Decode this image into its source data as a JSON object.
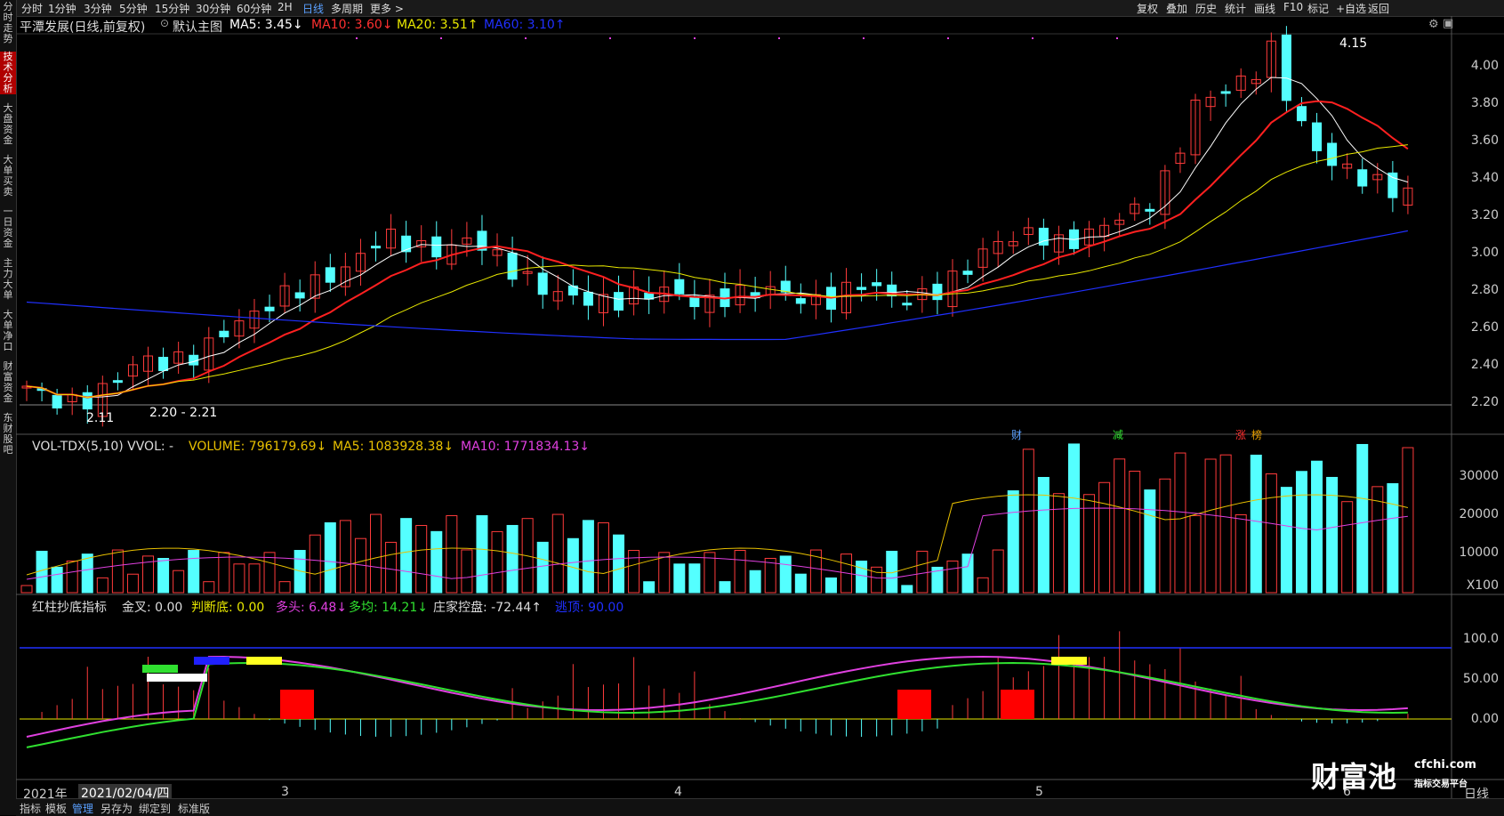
{
  "topbar": {
    "timeframes": [
      "分时",
      "1分钟",
      "3分钟",
      "5分钟",
      "15分钟",
      "30分钟",
      "60分钟",
      "2H",
      "日线",
      "多周期",
      "更多 >"
    ],
    "active": "日线",
    "right": [
      "复权",
      "叠加",
      "历史",
      "统计",
      "画线",
      "F10",
      "标记",
      "+自选",
      "返回"
    ]
  },
  "sidebar": [
    "分时走势",
    "技术分析",
    "大盘资金",
    "大单买卖",
    "一日资金",
    "主力大单",
    "大单净口",
    "财富资金",
    "东财股吧"
  ],
  "sidebar_active": "技术分析",
  "main": {
    "title": "平潭发展(日线,前复权)",
    "template": "默认主图",
    "ma5": "MA5: 3.45↓",
    "ma10": "MA10: 3.60↓",
    "ma20": "MA20: 3.51↑",
    "ma60": "MA60: 3.10↑",
    "high_mark": "4.15",
    "low_mark": "2.11",
    "low_range": "2.20 - 2.21",
    "yticks": [
      "4.00",
      "3.80",
      "3.60",
      "3.40",
      "3.20",
      "3.00",
      "2.80",
      "2.60",
      "2.40",
      "2.20"
    ],
    "events": [
      "财",
      "减",
      "涨",
      "榜"
    ]
  },
  "volume": {
    "title": "VOL-TDX(5,10) VVOL: -",
    "volume": "VOLUME: 796179.69↓",
    "ma5": "MA5: 1083928.38↓",
    "ma10": "MA10: 1771834.13↓",
    "yticks": [
      "30000",
      "20000",
      "10000"
    ],
    "unit": "X100"
  },
  "indicator": {
    "title": "红柱抄底指标",
    "jincha": "金叉: 0.00",
    "panduandi": "判断底: 0.00",
    "duotou": "多头: 6.48↓",
    "duojun": "多均: 14.21↓",
    "zhuangjia": "庄家控盘: -72.44↑",
    "taoding": "逃顶: 90.00",
    "yticks": [
      "100.0",
      "50.00",
      "0.00"
    ]
  },
  "xaxis": {
    "year": "2021年",
    "cursor_date": "2021/02/04/四",
    "months": [
      "3",
      "4",
      "5",
      "6"
    ],
    "period": "日线"
  },
  "bottombar": [
    "指标",
    "模板",
    "管理",
    "另存为",
    "绑定到",
    "标准版"
  ],
  "bottombar_active": "管理",
  "watermark": {
    "logo": "财富池",
    "url": "cfchi.com",
    "tagline": "指标交易平台"
  },
  "colors": {
    "up": "#ff3b3b",
    "down": "#54ffff",
    "ma5": "#ffffff",
    "ma10": "#ff2020",
    "ma20": "#e8e800",
    "ma60": "#2030ff",
    "magenta": "#e040e0",
    "green": "#30e030"
  }
}
